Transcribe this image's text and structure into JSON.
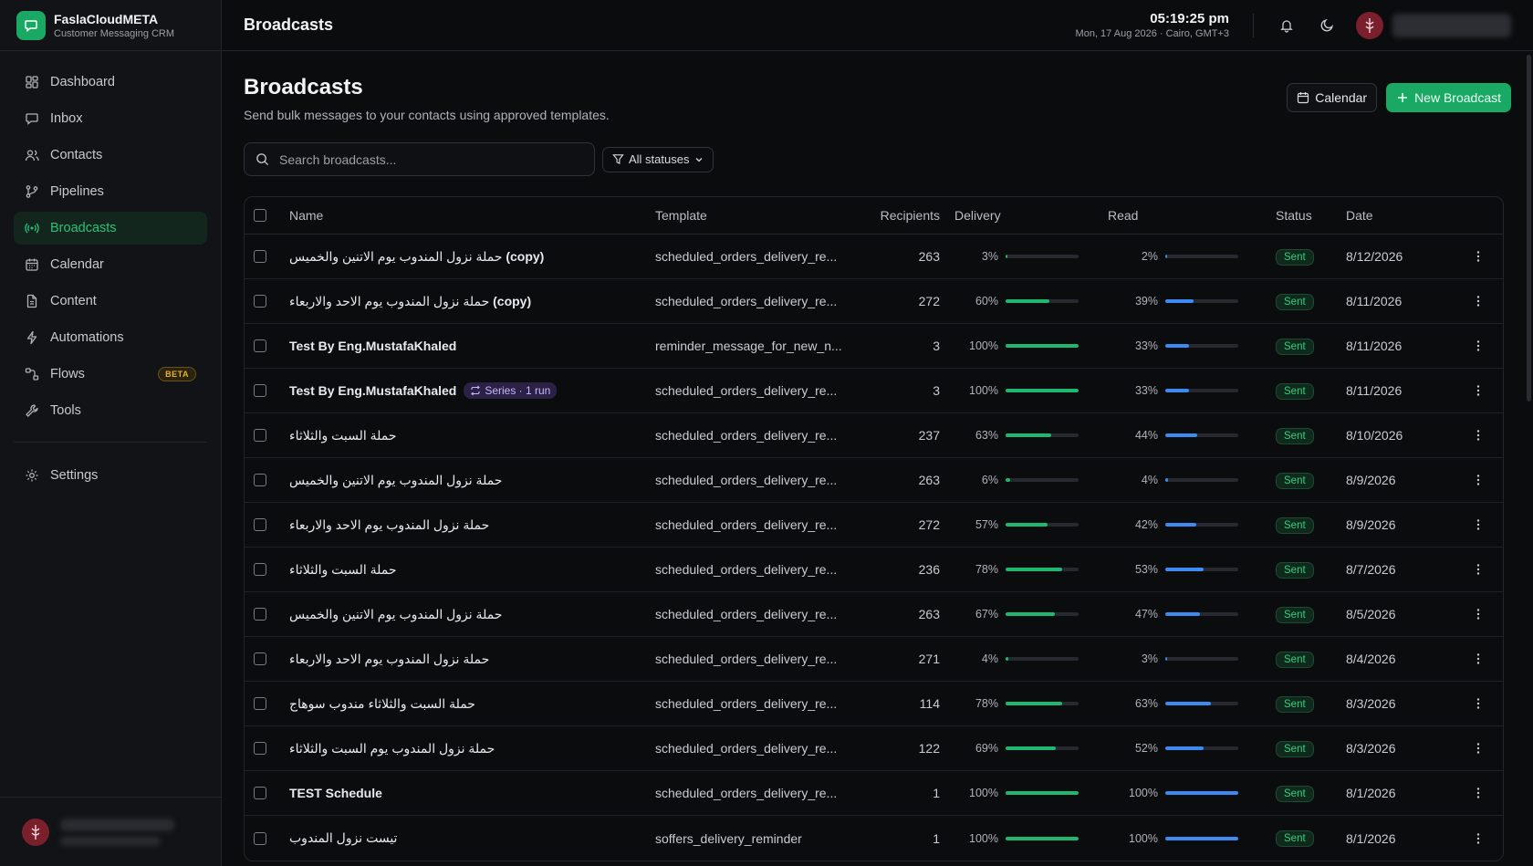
{
  "brand": {
    "title": "FaslaCloudMETA",
    "subtitle": "Customer Messaging CRM"
  },
  "nav": {
    "items": [
      {
        "label": "Dashboard",
        "icon": "dashboard-icon"
      },
      {
        "label": "Inbox",
        "icon": "inbox-icon"
      },
      {
        "label": "Contacts",
        "icon": "contacts-icon"
      },
      {
        "label": "Pipelines",
        "icon": "pipelines-icon"
      },
      {
        "label": "Broadcasts",
        "icon": "broadcast-icon",
        "active": true
      },
      {
        "label": "Calendar",
        "icon": "calendar-icon"
      },
      {
        "label": "Content",
        "icon": "content-icon"
      },
      {
        "label": "Automations",
        "icon": "automations-icon"
      },
      {
        "label": "Flows",
        "icon": "flows-icon",
        "badge": "BETA"
      },
      {
        "label": "Tools",
        "icon": "tools-icon"
      }
    ],
    "settings": "Settings"
  },
  "topbar": {
    "title": "Broadcasts",
    "time": "05:19:25 pm",
    "date": "Mon, 17 Aug 2026 · Cairo, GMT+3"
  },
  "page": {
    "title": "Broadcasts",
    "subtitle": "Send bulk messages to your contacts using approved templates.",
    "calendar_btn": "Calendar",
    "new_btn": "New Broadcast",
    "search_placeholder": "Search broadcasts...",
    "status_filter": "All statuses"
  },
  "table": {
    "headers": {
      "name": "Name",
      "template": "Template",
      "recipients": "Recipients",
      "delivery": "Delivery",
      "read": "Read",
      "status": "Status",
      "date": "Date"
    },
    "rows": [
      {
        "name": "حملة نزول المندوب يوم الاتنين والخميس",
        "suffix": " (copy)",
        "template": "scheduled_orders_delivery_re...",
        "recipients": "263",
        "delivery": 3,
        "read": 2,
        "status": "Sent",
        "date": "8/12/2026"
      },
      {
        "name": "حملة نزول المندوب يوم الاحد والاربعاء",
        "suffix": " (copy)",
        "template": "scheduled_orders_delivery_re...",
        "recipients": "272",
        "delivery": 60,
        "read": 39,
        "status": "Sent",
        "date": "8/11/2026"
      },
      {
        "name": "Test By Eng.MustafaKhaled",
        "bold": true,
        "template": "reminder_message_for_new_n...",
        "recipients": "3",
        "delivery": 100,
        "read": 33,
        "status": "Sent",
        "date": "8/11/2026"
      },
      {
        "name": "Test By Eng.MustafaKhaled",
        "bold": true,
        "series": "Series · 1 run",
        "template": "scheduled_orders_delivery_re...",
        "recipients": "3",
        "delivery": 100,
        "read": 33,
        "status": "Sent",
        "date": "8/11/2026"
      },
      {
        "name": "حملة السبت والثلاثاء",
        "template": "scheduled_orders_delivery_re...",
        "recipients": "237",
        "delivery": 63,
        "read": 44,
        "status": "Sent",
        "date": "8/10/2026"
      },
      {
        "name": "حملة نزول المندوب يوم الاتنين والخميس",
        "template": "scheduled_orders_delivery_re...",
        "recipients": "263",
        "delivery": 6,
        "read": 4,
        "status": "Sent",
        "date": "8/9/2026"
      },
      {
        "name": "حملة نزول المندوب يوم الاحد والاربعاء",
        "template": "scheduled_orders_delivery_re...",
        "recipients": "272",
        "delivery": 57,
        "read": 42,
        "status": "Sent",
        "date": "8/9/2026"
      },
      {
        "name": "حملة السبت والثلاثاء",
        "template": "scheduled_orders_delivery_re...",
        "recipients": "236",
        "delivery": 78,
        "read": 53,
        "status": "Sent",
        "date": "8/7/2026"
      },
      {
        "name": "حملة نزول المندوب يوم الاتنين والخميس",
        "template": "scheduled_orders_delivery_re...",
        "recipients": "263",
        "delivery": 67,
        "read": 47,
        "status": "Sent",
        "date": "8/5/2026"
      },
      {
        "name": "حملة نزول المندوب يوم الاحد والاربعاء",
        "template": "scheduled_orders_delivery_re...",
        "recipients": "271",
        "delivery": 4,
        "read": 3,
        "status": "Sent",
        "date": "8/4/2026"
      },
      {
        "name": "حملة السبت والثلاثاء مندوب سوهاج",
        "template": "scheduled_orders_delivery_re...",
        "recipients": "114",
        "delivery": 78,
        "read": 63,
        "status": "Sent",
        "date": "8/3/2026"
      },
      {
        "name": "حملة نزول المندوب يوم السبت والثلاثاء",
        "template": "scheduled_orders_delivery_re...",
        "recipients": "122",
        "delivery": 69,
        "read": 52,
        "status": "Sent",
        "date": "8/3/2026"
      },
      {
        "name": "TEST Schedule",
        "bold": true,
        "template": "scheduled_orders_delivery_re...",
        "recipients": "1",
        "delivery": 100,
        "read": 100,
        "status": "Sent",
        "date": "8/1/2026"
      },
      {
        "name": "تيست نزول المندوب",
        "template": "soffers_delivery_reminder",
        "recipients": "1",
        "delivery": 100,
        "read": 100,
        "status": "Sent",
        "date": "8/1/2026"
      }
    ]
  },
  "colors": {
    "accent": "#1aa865",
    "read_bar": "#3d8bf2",
    "background": "#0b0c0e"
  }
}
